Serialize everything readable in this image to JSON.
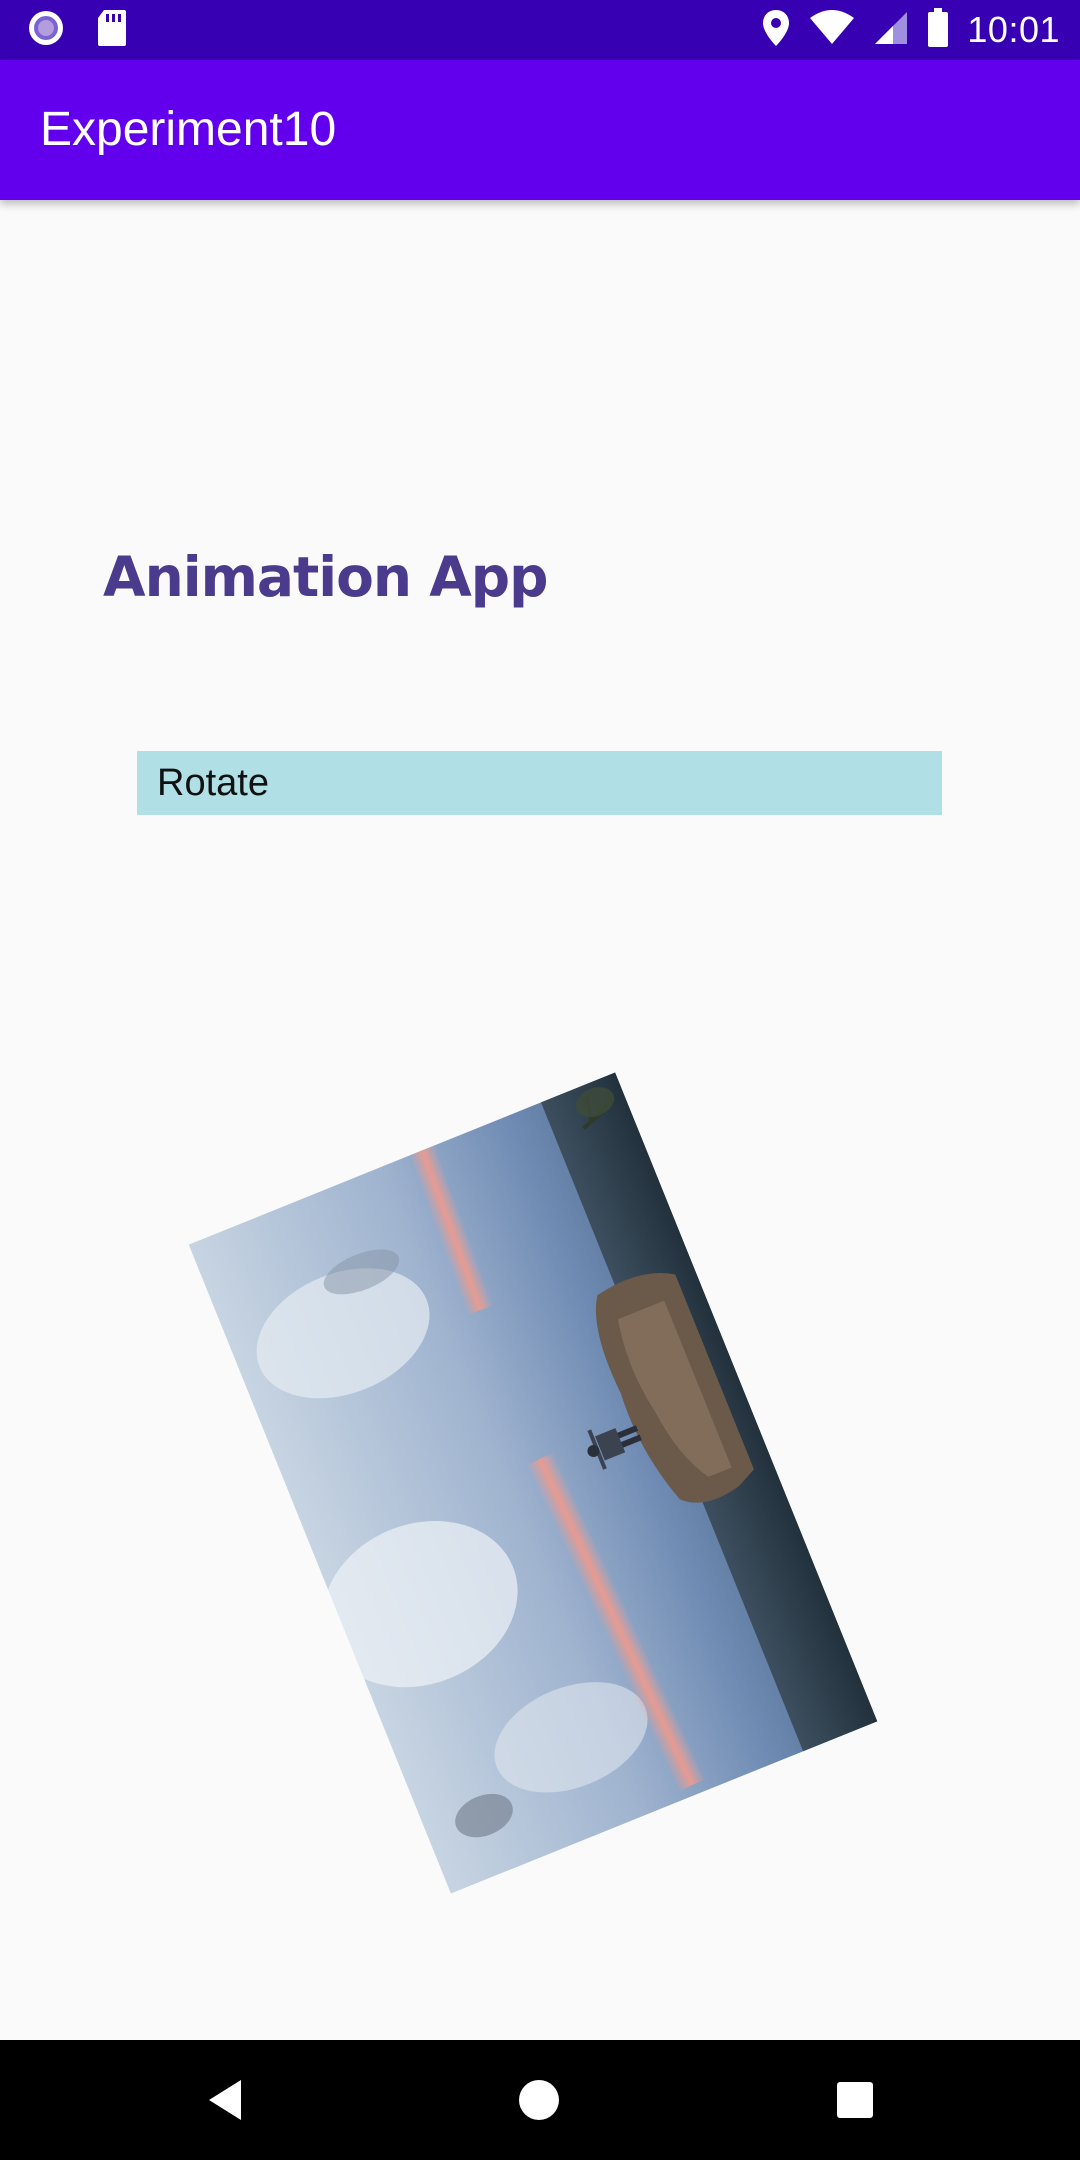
{
  "status_bar": {
    "time": "10:01",
    "left_icons": [
      "app-notification-icon",
      "sd-card-icon"
    ],
    "right_icons": [
      "location-icon",
      "wifi-icon",
      "signal-icon",
      "battery-icon"
    ],
    "color": "#3700b3"
  },
  "app_bar": {
    "title": "Experiment10",
    "color": "#6200ee"
  },
  "main": {
    "heading": "Animation App",
    "heading_color": "#4a3b8c",
    "rotate_button_label": "Rotate",
    "button_color": "#b0e0e6",
    "image": {
      "icon": "landscape-photo",
      "rotation_deg": -22
    }
  },
  "nav_bar": {
    "buttons": [
      "back-icon",
      "home-icon",
      "recents-icon"
    ]
  }
}
